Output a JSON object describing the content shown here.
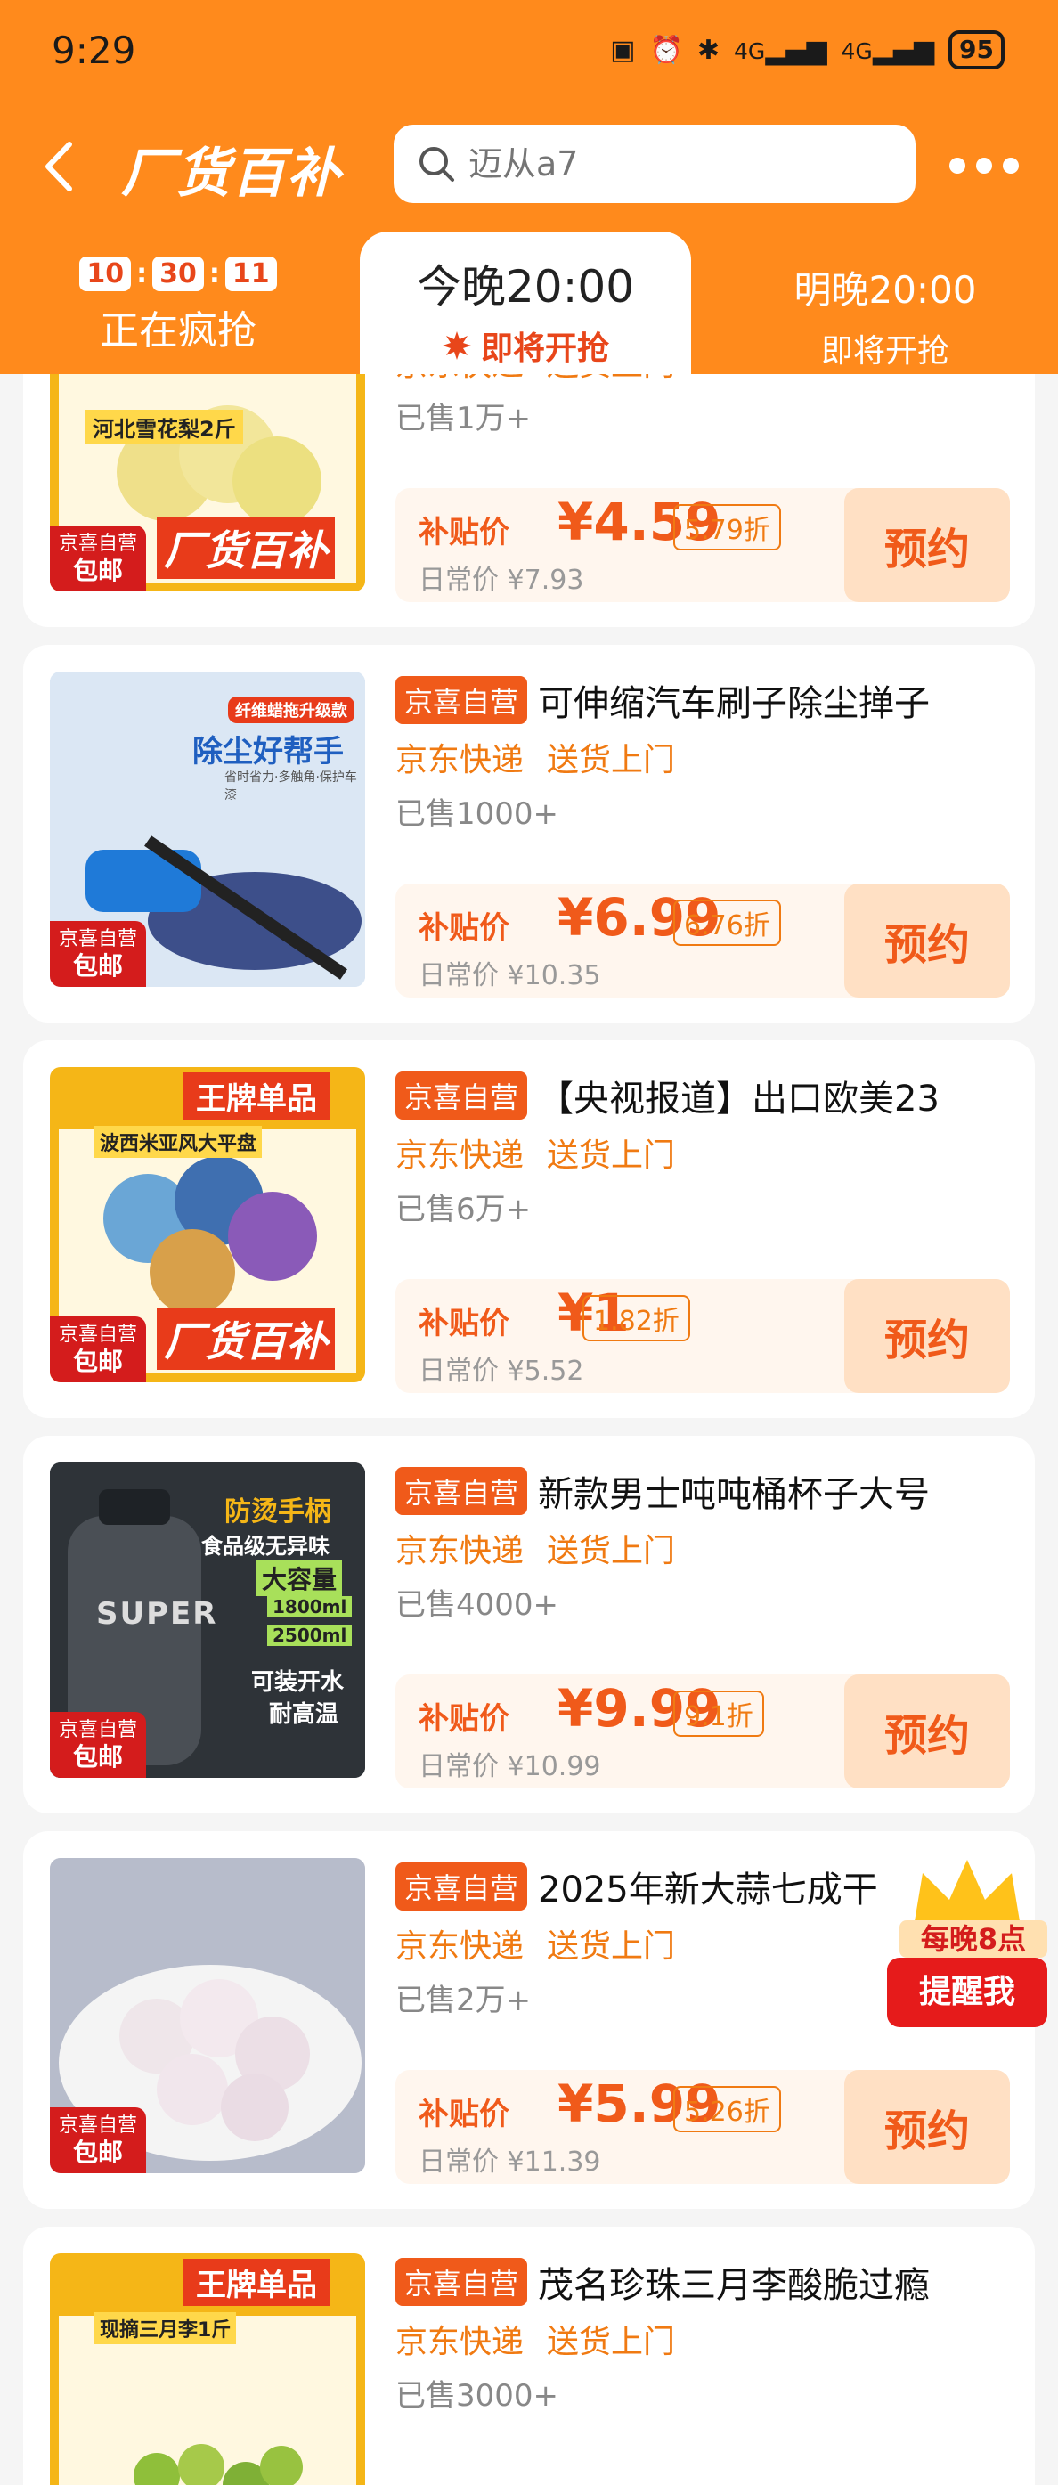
{
  "status_bar": {
    "time": "9:29",
    "battery": "95",
    "network": "4G"
  },
  "nav": {
    "brand_title": "厂货百补",
    "search_placeholder": "迈从a7"
  },
  "tabs": {
    "now": {
      "countdown": [
        "10",
        "30",
        "11"
      ],
      "label": "正在疯抢"
    },
    "tonight": {
      "time": "今晚20:00",
      "label": "即将开抢"
    },
    "tomorrow": {
      "time": "明晚20:00",
      "label": "即将开抢"
    }
  },
  "thumb_badge": {
    "line1": "京喜自营",
    "line2": "包邮"
  },
  "reserve_label": "预约",
  "price_prefix": "补贴价",
  "products": [
    {
      "tag": "",
      "title": "",
      "delivery": [
        "京东快递",
        "送货上门"
      ],
      "sold": "已售1万+",
      "price": "¥4.59",
      "discount": "5.79折",
      "original": "日常价 ¥7.93",
      "thumb_text": [
        "河北雪花梨2斤",
        "厂货百补"
      ],
      "thumb_color": "#f5b617"
    },
    {
      "tag": "京喜自营",
      "title": "可伸缩汽车刷子除尘掸子",
      "delivery": [
        "京东快递",
        "送货上门"
      ],
      "sold": "已售1000+",
      "price": "¥6.99",
      "discount": "6.76折",
      "original": "日常价 ¥10.35",
      "thumb_text": [
        "纤维蜡拖升级款",
        "除尘好帮手",
        "省时省力·多触角·保护车漆"
      ],
      "thumb_color": "#5a8fd8"
    },
    {
      "tag": "京喜自营",
      "title": "【央视报道】出口欧美23",
      "delivery": [
        "京东快递",
        "送货上门"
      ],
      "sold": "已售6万+",
      "price": "¥1",
      "discount": "1.82折",
      "original": "日常价 ¥5.52",
      "thumb_text": [
        "王牌单品",
        "波西米亚风大平盘",
        "厂货百补"
      ],
      "thumb_color": "#f5b617"
    },
    {
      "tag": "京喜自营",
      "title": "新款男士吨吨桶杯子大号",
      "delivery": [
        "京东快递",
        "送货上门"
      ],
      "sold": "已售4000+",
      "price": "¥9.99",
      "discount": "9.1折",
      "original": "日常价 ¥10.99",
      "thumb_text": [
        "防烫手柄",
        "食品级无异味",
        "大容量",
        "1800ml",
        "2500ml",
        "可装开水",
        "耐高温",
        "SUPER"
      ],
      "thumb_color": "#2e3338"
    },
    {
      "tag": "京喜自营",
      "title": "2025年新大蒜七成干",
      "delivery": [
        "京东快递",
        "送货上门"
      ],
      "sold": "已售2万+",
      "price": "¥5.99",
      "discount": "5.26折",
      "original": "日常价 ¥11.39",
      "thumb_text": [],
      "thumb_color": "#c9ccd6"
    },
    {
      "tag": "京喜自营",
      "title": "茂名珍珠三月李酸脆过瘾",
      "delivery": [
        "京东快递",
        "送货上门"
      ],
      "sold": "已售3000+",
      "price": "",
      "discount": "",
      "original": "",
      "thumb_text": [
        "王牌单品",
        "现摘三月李1斤"
      ],
      "thumb_color": "#f5b617"
    }
  ],
  "reminder": {
    "top": "每晚8点",
    "button": "提醒我"
  },
  "colors": {
    "brand_orange": "#ff8a1c",
    "accent_red": "#f05a1a",
    "delivery_orange": "#f07a12"
  }
}
